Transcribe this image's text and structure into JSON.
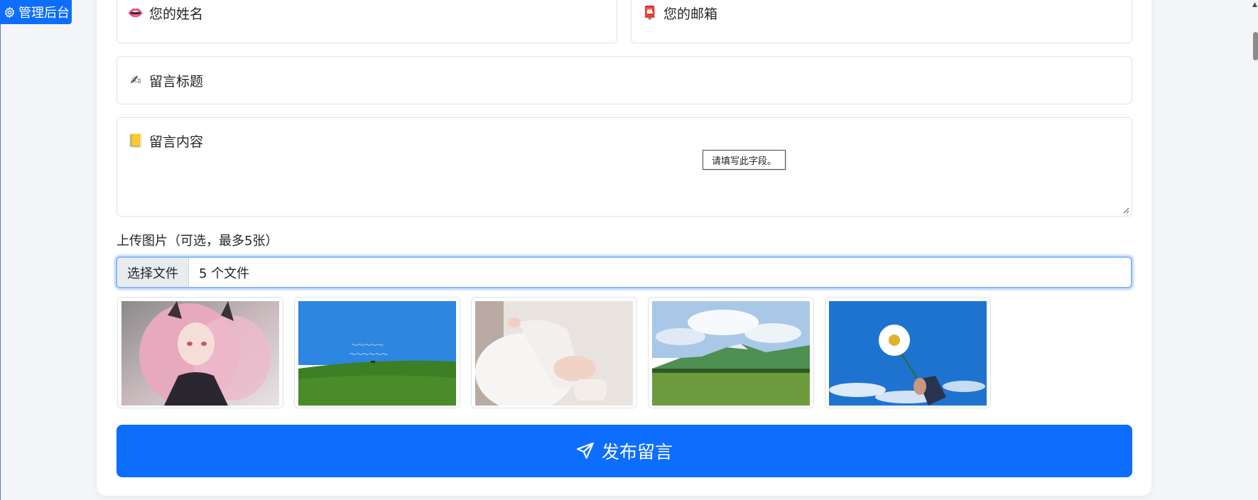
{
  "admin": {
    "label": "管理后台"
  },
  "form": {
    "name_placeholder": "您的姓名",
    "email_placeholder": "您的邮箱",
    "title_placeholder": "留言标题",
    "content_placeholder": "留言内容",
    "validation_tooltip": "请填写此字段。",
    "upload_label": "上传图片（可选，最多5张）",
    "file_button": "选择文件",
    "file_status": "5 个文件",
    "submit_label": "发布留言"
  },
  "icons": {
    "name_emoji": "👄",
    "email_emoji": "📮",
    "title_emoji": "✍",
    "content_emoji": "📒",
    "admin_icon": "gear-icon",
    "submit_icon": "send-icon"
  },
  "colors": {
    "primary": "#0d6efd",
    "focus_border": "#86b7fe",
    "field_border": "#dee2e6"
  }
}
